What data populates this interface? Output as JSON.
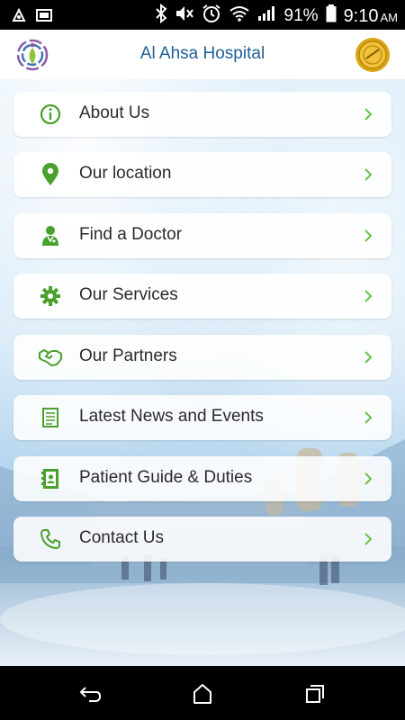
{
  "status_bar": {
    "battery_percent": "91%",
    "time": "9:10",
    "ampm": "AM"
  },
  "header": {
    "title": "Al Ahsa Hospital"
  },
  "menu": [
    {
      "label": "About Us",
      "icon": "info-icon"
    },
    {
      "label": "Our location",
      "icon": "location-pin-icon"
    },
    {
      "label": "Find a Doctor",
      "icon": "doctor-icon"
    },
    {
      "label": "Our Services",
      "icon": "gear-icon"
    },
    {
      "label": "Our Partners",
      "icon": "handshake-icon"
    },
    {
      "label": "Latest News and Events",
      "icon": "document-icon"
    },
    {
      "label": "Patient Guide & Duties",
      "icon": "contact-book-icon"
    },
    {
      "label": "Contact Us",
      "icon": "phone-icon"
    }
  ],
  "colors": {
    "accent_green": "#4aa02c",
    "title_blue": "#1f5f98",
    "chevron_green": "#6cc04a"
  },
  "nav": [
    "back-icon",
    "home-icon",
    "recent-apps-icon"
  ]
}
